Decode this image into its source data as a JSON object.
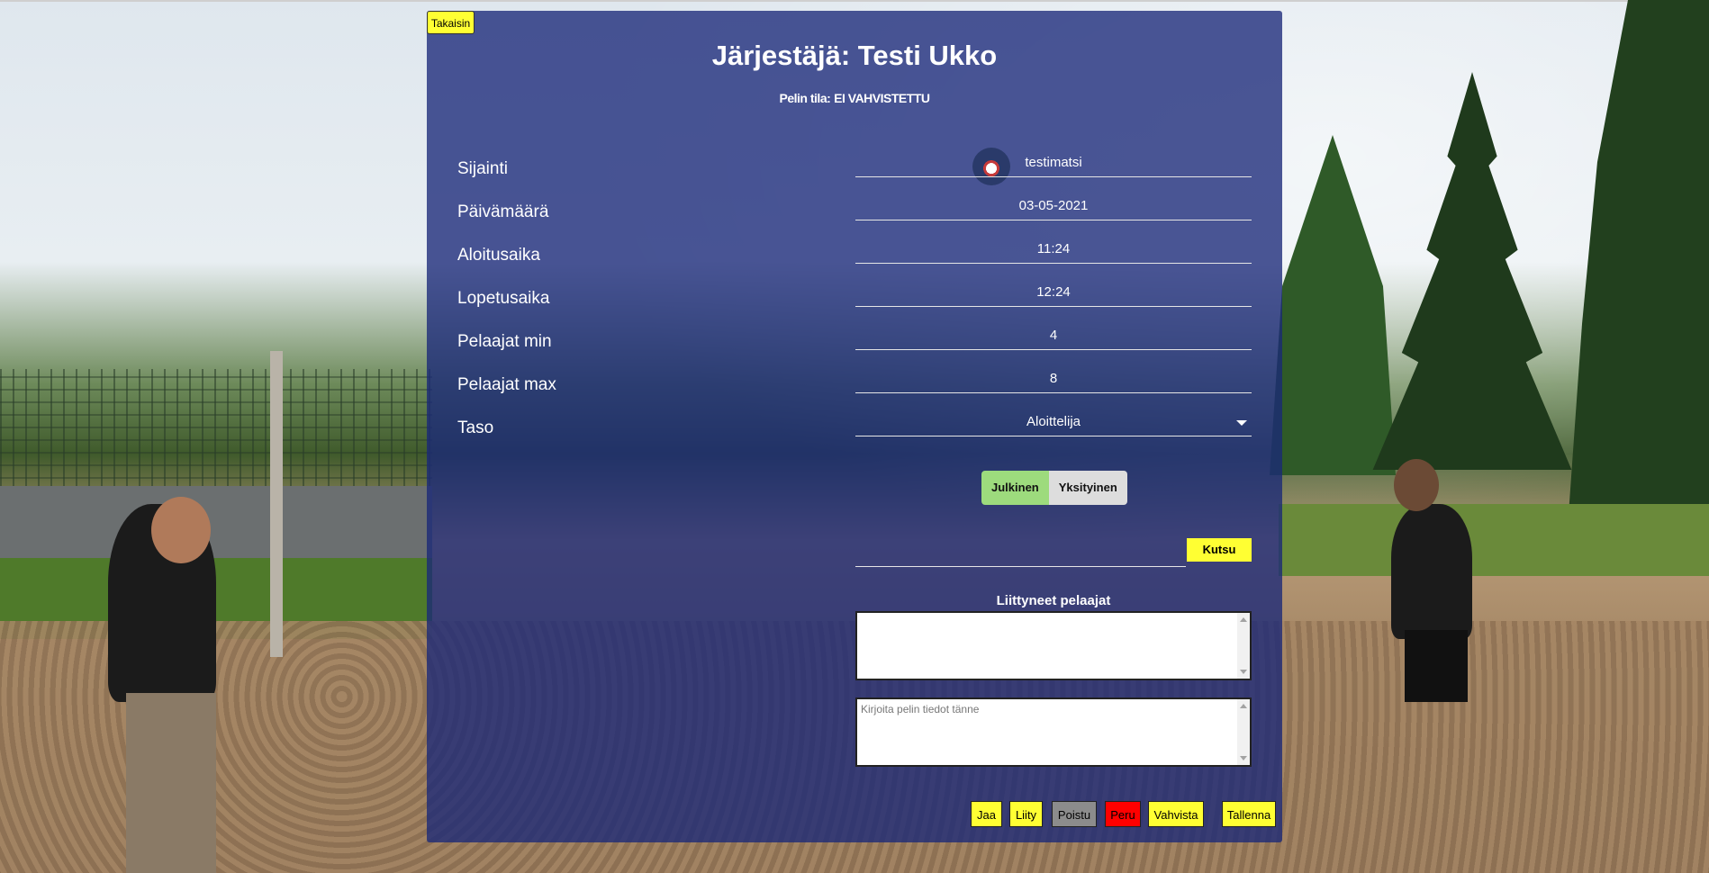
{
  "nav": {
    "back_label": "Takaisin"
  },
  "header": {
    "title": "Järjestäjä: Testi Ukko",
    "status_label": "Pelin tila:",
    "status_value": "EI VAHVISTETTU"
  },
  "fields": [
    {
      "label": "Sijainti",
      "value": "testimatsi"
    },
    {
      "label": "Päivämäärä",
      "value": "03-05-2021"
    },
    {
      "label": "Aloitusaika",
      "value": "11:24"
    },
    {
      "label": "Lopetusaika",
      "value": "12:24"
    },
    {
      "label": "Pelaajat min",
      "value": "4"
    },
    {
      "label": "Pelaajat max",
      "value": "8"
    },
    {
      "label": "Taso",
      "value": "Aloittelija"
    }
  ],
  "visibility": {
    "public_label": "Julkinen",
    "private_label": "Yksityinen",
    "selected": "Julkinen"
  },
  "invite": {
    "button_label": "Kutsu",
    "value": ""
  },
  "joined": {
    "title": "Liittyneet pelaajat"
  },
  "details": {
    "placeholder": "Kirjoita pelin tiedot tänne"
  },
  "actions": {
    "share": "Jaa",
    "join": "Liity",
    "leave": "Poistu",
    "cancel": "Peru",
    "confirm": "Vahvista",
    "save": "Tallenna"
  },
  "colors": {
    "panel": "#1a2878",
    "button_yellow": "#ffff33",
    "toggle_on": "#9ddb7d",
    "toggle_off": "#dddddd",
    "cancel_red": "#ff0000",
    "leave_gray": "#8c8c8c"
  }
}
